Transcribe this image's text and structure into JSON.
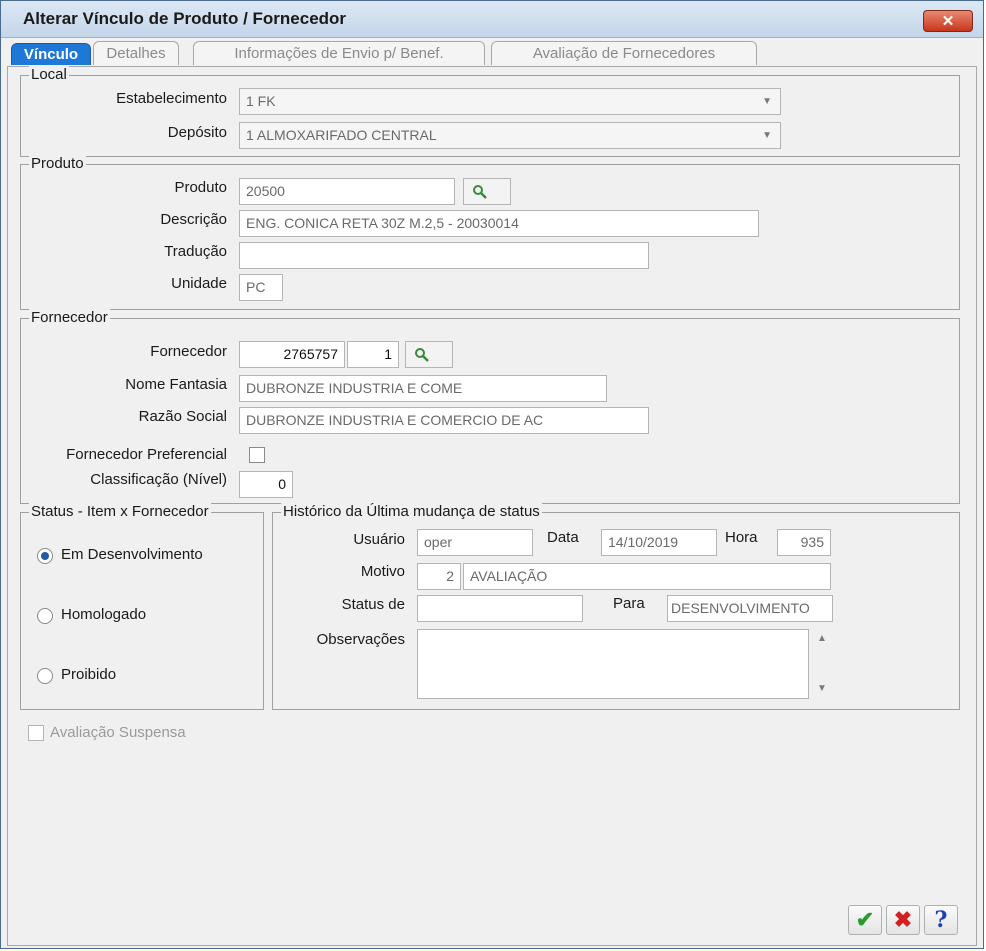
{
  "window": {
    "title": "Alterar Vínculo de Produto / Fornecedor",
    "close_icon": "✕"
  },
  "tabs": [
    {
      "label": "Vínculo",
      "active": true
    },
    {
      "label": "Detalhes",
      "active": false
    },
    {
      "label": "Informações de Envio p/ Benef.",
      "active": false
    },
    {
      "label": "Avaliação de Fornecedores",
      "active": false
    }
  ],
  "local": {
    "legend": "Local",
    "estabelecimento_label": "Estabelecimento",
    "estabelecimento_value": "1 FK",
    "deposito_label": "Depósito",
    "deposito_value": "1 ALMOXARIFADO CENTRAL"
  },
  "produto": {
    "legend": "Produto",
    "produto_label": "Produto",
    "produto_value": "20500",
    "descricao_label": "Descrição",
    "descricao_value": "ENG. CONICA RETA 30Z M.2,5 - 20030014",
    "traducao_label": "Tradução",
    "traducao_value": "",
    "unidade_label": "Unidade",
    "unidade_value": "PC"
  },
  "fornecedor": {
    "legend": "Fornecedor",
    "fornecedor_label": "Fornecedor",
    "fornecedor_code": "2765757",
    "fornecedor_seq": "1",
    "nome_fantasia_label": "Nome Fantasia",
    "nome_fantasia_value": "DUBRONZE INDUSTRIA E COME",
    "razao_social_label": "Razão Social",
    "razao_social_value": "DUBRONZE INDUSTRIA E COMERCIO DE AC",
    "preferencial_label": "Fornecedor Preferencial",
    "preferencial_checked": false,
    "classificacao_label": "Classificação (Nível)",
    "classificacao_value": "0"
  },
  "status": {
    "legend": "Status - Item x Fornecedor",
    "options": [
      {
        "label": "Em Desenvolvimento",
        "selected": true
      },
      {
        "label": "Homologado",
        "selected": false
      },
      {
        "label": "Proibido",
        "selected": false
      }
    ]
  },
  "historico": {
    "legend": "Histórico da Última mudança de status",
    "usuario_label": "Usuário",
    "usuario_value": "oper",
    "data_label": "Data",
    "data_value": "14/10/2019",
    "hora_label": "Hora",
    "hora_value": "935",
    "motivo_label": "Motivo",
    "motivo_code": "2",
    "motivo_value": "AVALIAÇÃO",
    "status_de_label": "Status de",
    "status_de_value": "",
    "para_label": "Para",
    "para_value": "DESENVOLVIMENTO",
    "observacoes_label": "Observações",
    "observacoes_value": ""
  },
  "avaliacao_suspensa": {
    "label": "Avaliação Suspensa",
    "checked": false
  },
  "buttons": {
    "ok_symbol": "✔",
    "cancel_symbol": "✖",
    "help_symbol": "?"
  },
  "colors": {
    "tab_active": "#1e78d8",
    "ok": "#2a9a2a",
    "cancel": "#d42020",
    "help": "#1e3fb8"
  }
}
